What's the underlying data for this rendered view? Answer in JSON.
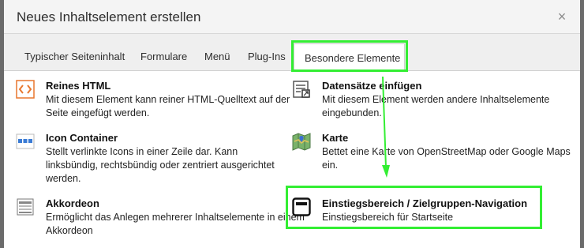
{
  "dialog": {
    "title": "Neues Inhaltselement erstellen",
    "close_symbol": "×"
  },
  "tabs": [
    {
      "label": "Typischer Seiteninhalt"
    },
    {
      "label": "Formulare"
    },
    {
      "label": "Menü"
    },
    {
      "label": "Plug-Ins"
    },
    {
      "label": "Besondere Elemente",
      "active": true
    }
  ],
  "items": [
    {
      "title": "Reines HTML",
      "description": "Mit diesem Element kann reiner HTML-Quelltext auf der Seite eingefügt werden.",
      "icon": "html-code-icon"
    },
    {
      "title": "Datensätze einfügen",
      "description": "Mit diesem Element werden andere Inhaltselemente eingebunden.",
      "icon": "insert-records-icon"
    },
    {
      "title": "Icon Container",
      "description": "Stellt verlinkte Icons in einer Zeile dar. Kann linksbündig, rechtsbündig oder zentriert ausgerichtet werden.",
      "icon": "icon-container-icon"
    },
    {
      "title": "Karte",
      "description": "Bettet eine Karte von OpenStreetMap oder Google Maps ein.",
      "icon": "map-icon"
    },
    {
      "title": "Akkordeon",
      "description": "Ermöglicht das Anlegen mehrerer Inhaltselemente in einem Akkordeon",
      "icon": "accordion-icon"
    },
    {
      "title": "Einstiegsbereich / Zielgruppen-Navigation",
      "description": "Einstiegsbereich für Startseite",
      "icon": "entry-area-icon"
    }
  ],
  "colors": {
    "highlight": "#33ee33",
    "html_icon_orange": "#e8772e",
    "icon_container_blue": "#3a7bd5"
  }
}
